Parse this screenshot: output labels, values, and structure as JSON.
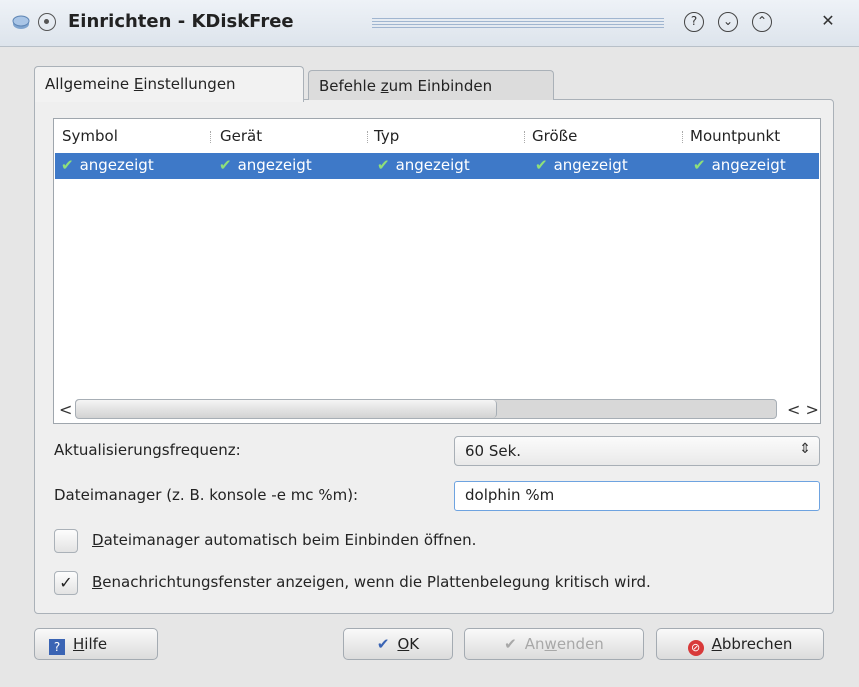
{
  "window": {
    "title": "Einrichten - KDiskFree",
    "help_glyph": "?",
    "minimize_glyph": "⌄",
    "maximize_glyph": "⌃",
    "close_glyph": "✕"
  },
  "tabs": [
    {
      "pre": "Allgemeine ",
      "u": "E",
      "post": "instellungen",
      "active": true
    },
    {
      "pre": "Befehle ",
      "u": "z",
      "post": "um Einbinden",
      "active": false
    }
  ],
  "table": {
    "columns": [
      "Symbol",
      "Gerät",
      "Typ",
      "Größe",
      "Mountpunkt"
    ],
    "rows": [
      {
        "selected": true,
        "cells": [
          "angezeigt",
          "angezeigt",
          "angezeigt",
          "angezeigt",
          "angezeigt"
        ],
        "check_icon": "check-icon",
        "check_color": "#8fe07a"
      }
    ]
  },
  "scroll": {
    "left": "<",
    "right": "< >"
  },
  "settings": {
    "frequency_label": "Aktualisierungsfrequenz:",
    "frequency_value": "60 Sek.",
    "filemanager_label": "Dateimanager (z. B. konsole -e mc %m):",
    "filemanager_value": "dolphin %m",
    "auto_open": {
      "u": "D",
      "rest": "ateimanager automatisch beim Einbinden öffnen.",
      "checked": false
    },
    "notify": {
      "u": "B",
      "rest": "enachrichtungsfenster anzeigen, wenn die Plattenbelegung kritisch wird.",
      "checked": true,
      "mark": "✓"
    }
  },
  "buttons": {
    "help": {
      "u": "H",
      "rest": "ilfe"
    },
    "ok": {
      "u": "O",
      "rest": "K",
      "icon": "✔"
    },
    "apply": {
      "pre": "An",
      "u": "w",
      "post": "enden",
      "icon": "✔",
      "disabled": true
    },
    "cancel": {
      "u": "A",
      "rest": "bbrechen"
    }
  },
  "colors": {
    "selection": "#3e79c8",
    "focus_border": "#6ea3e0",
    "cancel_icon": "#d83a3a"
  }
}
